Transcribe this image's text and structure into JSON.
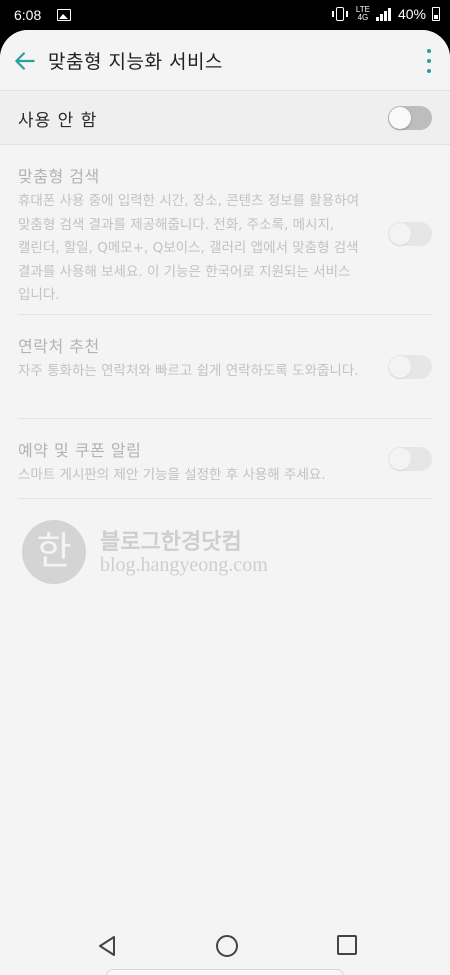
{
  "status_bar": {
    "time": "6:08",
    "lte_label_top": "LTE",
    "lte_label_bottom": "4G",
    "battery_percent": "40%",
    "icons": [
      "image-icon",
      "vibrate-icon",
      "lte-icon",
      "signal-icon",
      "battery-icon"
    ]
  },
  "header": {
    "title": "맞춤형 지능화 서비스",
    "back_icon": "arrow-left-icon",
    "more_icon": "more-vert-icon",
    "accent_color": "#2a9d9d"
  },
  "master_switch": {
    "label": "사용 안 함",
    "on": false
  },
  "settings": [
    {
      "title": "맞춤형 검색",
      "description": "휴대폰 사용 중에 입력한 시간, 장소, 콘텐츠 정보를 활용하여 맞춤형 검색 결과를 제공해줍니다. 전화, 주소록, 메시지, 캘린더, 할일, Q메모+, Q보이스, 갤러리 앱에서 맞춤형 검색 결과를 사용해 보세요. 이 기능은 한국어로 지원되는 서비스 입니다.",
      "on": false,
      "enabled": false
    },
    {
      "title": "연락처 추천",
      "description": "자주 통화하는 연락처와 빠르고 쉽게 연락하도록 도와줍니다.",
      "on": false,
      "enabled": true
    },
    {
      "title": "예약 및 쿠폰 알림",
      "description": "스마트 게시판의 제안 기능을 설정한 후 사용해 주세요.",
      "on": false,
      "enabled": false
    }
  ],
  "watermark": {
    "seal_char": "한",
    "title": "블로그한경닷컴",
    "url": "blog.hangyeong.com"
  },
  "nav_bar": {
    "icons": [
      "nav-back-icon",
      "nav-home-icon",
      "nav-recent-icon"
    ]
  }
}
